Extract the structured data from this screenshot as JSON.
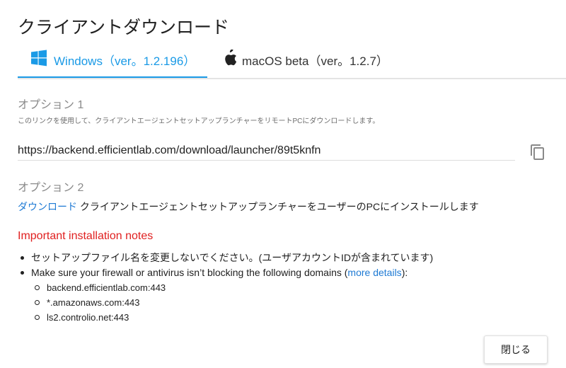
{
  "title": "クライアントダウンロード",
  "tabs": [
    {
      "label": "Windows（ver。1.2.196）",
      "icon": "windows-icon",
      "active": true
    },
    {
      "label": "macOS beta（ver。1.2.7）",
      "icon": "apple-icon",
      "active": false
    }
  ],
  "option1": {
    "title": "オプション 1",
    "description": "このリンクを使用して、クライアントエージェントセットアップランチャーをリモートPCにダウンロードします。",
    "url": "https://backend.efficientlab.com/download/launcher/89t5knfn"
  },
  "option2": {
    "title": "オプション 2",
    "link_label": "ダウンロード",
    "text": " クライアントエージェントセットアップランチャーをユーザーのPCにインストールします"
  },
  "notes": {
    "title": "Important installation notes",
    "item1": "セットアップファイル名を変更しないでください。(ユーザアカウントIDが含まれています)",
    "item2_prefix": "Make sure your firewall or antivirus isn’t blocking the following domains (",
    "item2_link": "more details",
    "item2_suffix": "):",
    "domains": [
      "backend.efficientlab.com:443",
      "*.amazonaws.com:443",
      "ls2.controlio.net:443"
    ]
  },
  "close_label": "閉じる",
  "colors": {
    "accent": "#1a9ae6",
    "link": "#1e7ad4",
    "warning": "#e02020"
  }
}
